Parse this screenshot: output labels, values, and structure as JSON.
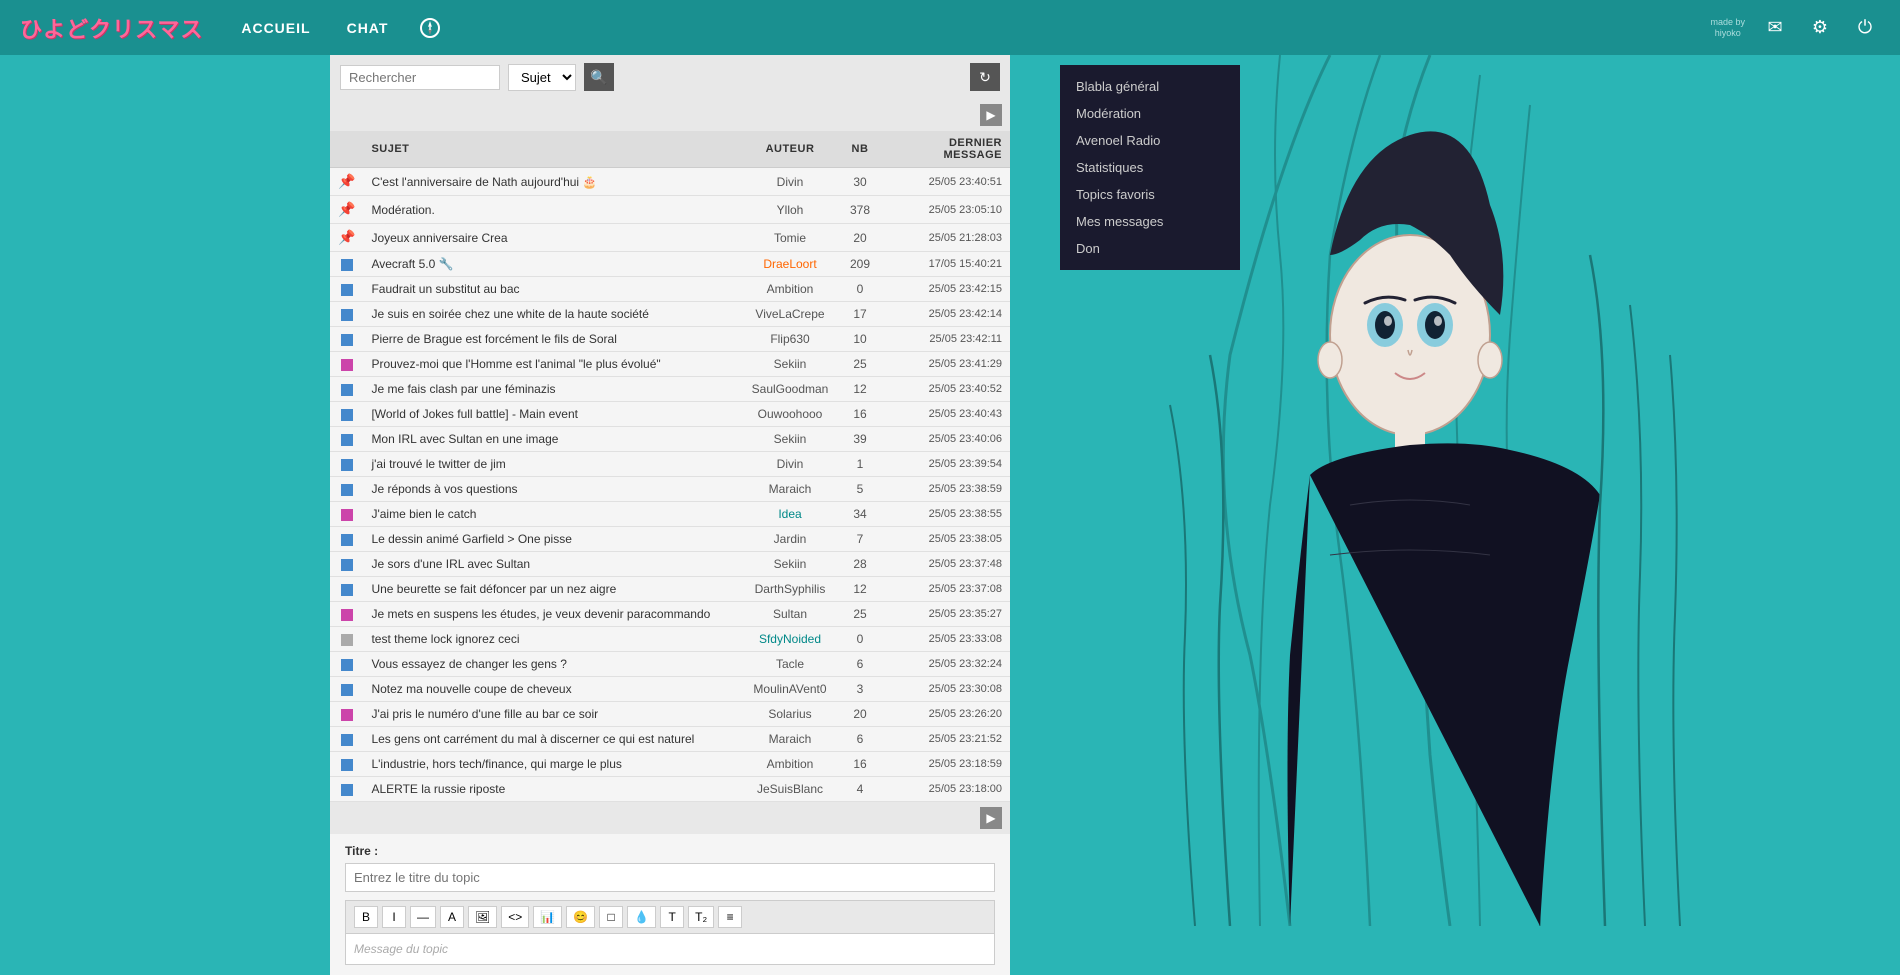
{
  "header": {
    "logo": "ひよどクリスマス",
    "nav": [
      {
        "label": "ACCUEIL",
        "active": false
      },
      {
        "label": "CHAT",
        "active": true
      }
    ],
    "made_by": "made by\nhiyoko",
    "icons": {
      "compass": "⊕",
      "mail": "✉",
      "gear": "⚙",
      "power": "⏻"
    }
  },
  "search": {
    "placeholder": "Rechercher",
    "select_options": [
      "Sujet"
    ],
    "select_default": "Sujet"
  },
  "table": {
    "columns": [
      "SUJET",
      "AUTEUR",
      "NB",
      "DERNIER MESSAGE"
    ],
    "rows": [
      {
        "icon": "pin",
        "subject": "C'est l'anniversaire de Nath aujourd'hui 🎂",
        "author": "Divin",
        "author_style": "normal",
        "nb": "30",
        "date": "25/05 23:40:51"
      },
      {
        "icon": "pin",
        "subject": "Modération.",
        "author": "Ylloh",
        "author_style": "normal",
        "nb": "378",
        "date": "25/05 23:05:10"
      },
      {
        "icon": "pin",
        "subject": "Joyeux anniversaire Crea",
        "author": "Tomie",
        "author_style": "normal",
        "nb": "20",
        "date": "25/05 21:28:03"
      },
      {
        "icon": "blue",
        "subject": "Avecraft 5.0 🔧",
        "author": "DraeLoort",
        "author_style": "orange",
        "nb": "209",
        "date": "17/05 15:40:21"
      },
      {
        "icon": "blue",
        "subject": "Faudrait un substitut au bac",
        "author": "Ambition",
        "author_style": "normal",
        "nb": "0",
        "date": "25/05 23:42:15"
      },
      {
        "icon": "blue",
        "subject": "Je suis en soirée chez une white de la haute société",
        "author": "ViveLaCrepe",
        "author_style": "normal",
        "nb": "17",
        "date": "25/05 23:42:14"
      },
      {
        "icon": "blue",
        "subject": "Pierre de Brague est forcément le fils de Soral",
        "author": "Flip630",
        "author_style": "normal",
        "nb": "10",
        "date": "25/05 23:42:11"
      },
      {
        "icon": "pink",
        "subject": "Prouvez-moi que l'Homme est l'animal \"le plus évolué\"",
        "author": "Sekiin",
        "author_style": "normal",
        "nb": "25",
        "date": "25/05 23:41:29"
      },
      {
        "icon": "blue",
        "subject": "Je me fais clash par une féminazis",
        "author": "SaulGoodman",
        "author_style": "normal",
        "nb": "12",
        "date": "25/05 23:40:52"
      },
      {
        "icon": "blue",
        "subject": "[World of Jokes full battle] - Main event",
        "author": "Ouwoohooo",
        "author_style": "normal",
        "nb": "16",
        "date": "25/05 23:40:43"
      },
      {
        "icon": "blue",
        "subject": "Mon IRL avec Sultan en une image",
        "author": "Sekiin",
        "author_style": "normal",
        "nb": "39",
        "date": "25/05 23:40:06"
      },
      {
        "icon": "blue",
        "subject": "j'ai trouvé le twitter de jim",
        "author": "Divin",
        "author_style": "normal",
        "nb": "1",
        "date": "25/05 23:39:54"
      },
      {
        "icon": "blue",
        "subject": "Je réponds à vos questions",
        "author": "Maraich",
        "author_style": "normal",
        "nb": "5",
        "date": "25/05 23:38:59"
      },
      {
        "icon": "pink",
        "subject": "J'aime bien le catch",
        "author": "Idea",
        "author_style": "teal",
        "nb": "34",
        "date": "25/05 23:38:55"
      },
      {
        "icon": "blue",
        "subject": "Le dessin animé Garfield > One pisse",
        "author": "Jardin",
        "author_style": "normal",
        "nb": "7",
        "date": "25/05 23:38:05"
      },
      {
        "icon": "blue",
        "subject": "Je sors d'une IRL avec Sultan",
        "author": "Sekiin",
        "author_style": "normal",
        "nb": "28",
        "date": "25/05 23:37:48"
      },
      {
        "icon": "blue",
        "subject": "Une beurette se fait défoncer par un nez aigre",
        "author": "DarthSyphilis",
        "author_style": "normal",
        "nb": "12",
        "date": "25/05 23:37:08"
      },
      {
        "icon": "pink",
        "subject": "Je mets en suspens les études, je veux devenir paracommando",
        "author": "Sultan",
        "author_style": "normal",
        "nb": "25",
        "date": "25/05 23:35:27"
      },
      {
        "icon": "gray",
        "subject": "test theme lock ignorez ceci",
        "author": "SfdyNoided",
        "author_style": "teal",
        "nb": "0",
        "date": "25/05 23:33:08"
      },
      {
        "icon": "blue",
        "subject": "Vous essayez de changer les gens ?",
        "author": "Tacle",
        "author_style": "normal",
        "nb": "6",
        "date": "25/05 23:32:24"
      },
      {
        "icon": "blue",
        "subject": "Notez ma nouvelle coupe de cheveux",
        "author": "MoulinAVent0",
        "author_style": "normal",
        "nb": "3",
        "date": "25/05 23:30:08"
      },
      {
        "icon": "pink",
        "subject": "J'ai pris le numéro d'une fille au bar ce soir",
        "author": "Solarius",
        "author_style": "normal",
        "nb": "20",
        "date": "25/05 23:26:20"
      },
      {
        "icon": "blue",
        "subject": "Les gens ont carrément du mal à discerner ce qui est naturel",
        "author": "Maraich",
        "author_style": "normal",
        "nb": "6",
        "date": "25/05 23:21:52"
      },
      {
        "icon": "blue",
        "subject": "L'industrie, hors tech/finance, qui marge le plus",
        "author": "Ambition",
        "author_style": "normal",
        "nb": "16",
        "date": "25/05 23:18:59"
      },
      {
        "icon": "blue",
        "subject": "ALERTE la russie riposte",
        "author": "JeSuisBlanc",
        "author_style": "normal",
        "nb": "4",
        "date": "25/05 23:18:00"
      }
    ]
  },
  "post": {
    "title_label": "Titre :",
    "title_placeholder": "Entrez le titre du topic",
    "message_placeholder": "Message du topic",
    "toolbar_buttons": [
      "B",
      "I",
      "—",
      "A",
      "🖼",
      "<>",
      "📊",
      "😊",
      "□",
      "💧",
      "T",
      "T₂",
      "≡"
    ]
  },
  "sidebar": {
    "items": [
      {
        "label": "Blabla général"
      },
      {
        "label": "Modération"
      },
      {
        "label": "Avenoel Radio"
      },
      {
        "label": "Statistiques"
      },
      {
        "label": "Topics favoris"
      },
      {
        "label": "Mes messages"
      },
      {
        "label": "Don"
      }
    ]
  },
  "colors": {
    "accent": "#2ab5b5",
    "header_bg": "#1a9090",
    "logo_color": "#ff6699",
    "sidebar_bg": "#1a1a2e",
    "orange": "#ff6600",
    "teal_author": "#008888"
  }
}
